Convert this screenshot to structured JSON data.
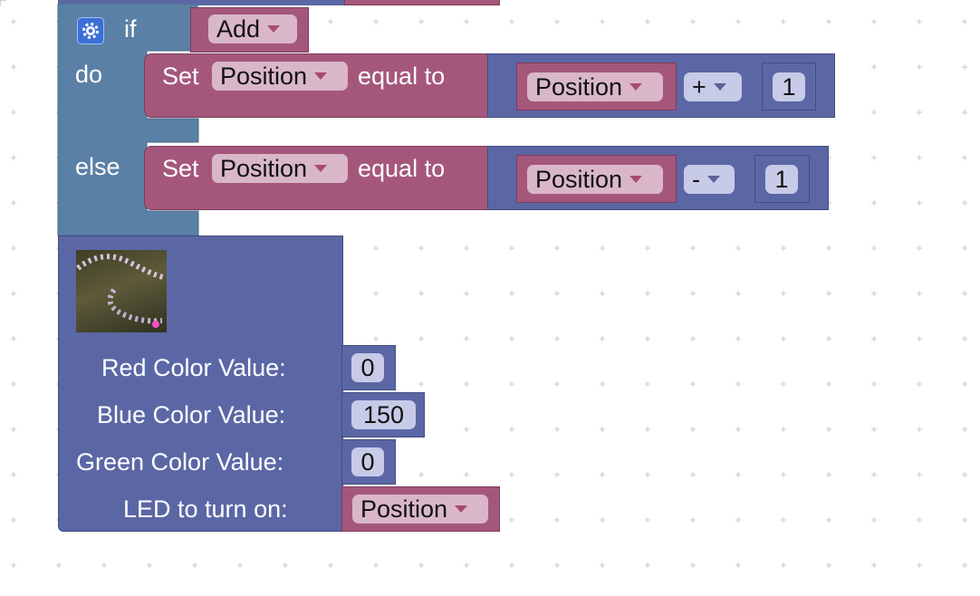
{
  "if_block": {
    "if_label": "if",
    "do_label": "do",
    "else_label": "else",
    "condition_value": "Add",
    "gear_icon": "gear-icon"
  },
  "do_branch": {
    "set_label": "Set",
    "variable": "Position",
    "equal_to_label": "equal to",
    "operand_variable": "Position",
    "operator": "+",
    "operand_number": "1"
  },
  "else_branch": {
    "set_label": "Set",
    "variable": "Position",
    "equal_to_label": "equal to",
    "operand_variable": "Position",
    "operator": "-",
    "operand_number": "1"
  },
  "led_block": {
    "image_icon": "led-strip-image",
    "red_label": "Red Color Value:",
    "red_value": "0",
    "blue_label": "Blue Color Value:",
    "blue_value": "150",
    "green_label": "Green Color Value:",
    "green_value": "0",
    "led_label": "LED to turn on:",
    "led_value": "Position"
  },
  "colors": {
    "control_block": "#5b80a5",
    "variable_block": "#a5577b",
    "math_block": "#5b67a5",
    "field_pink": "#d9b7c8",
    "field_blue": "#c7cbe8"
  }
}
